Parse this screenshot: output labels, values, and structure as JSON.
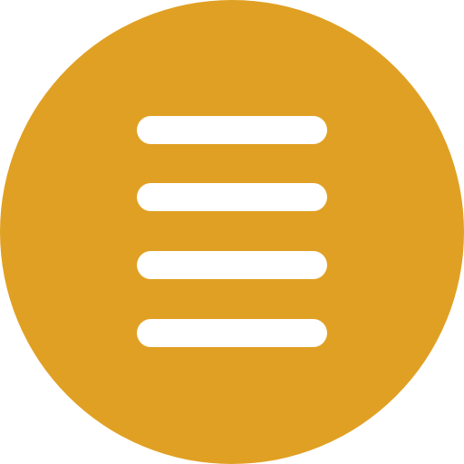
{
  "icon": {
    "name": "hamburger-menu-icon",
    "line_count": 4
  },
  "colors": {
    "circle": "#E0A023",
    "lines": "#FFFFFF"
  }
}
